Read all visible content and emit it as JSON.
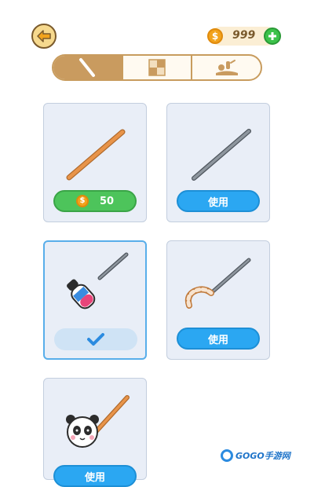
{
  "header": {
    "back_icon": "arrow-left-icon",
    "coins": "999",
    "coin_symbol": "$",
    "add_icon": "plus-icon"
  },
  "tabs": [
    {
      "icon": "stick-icon",
      "active": true
    },
    {
      "icon": "checker-icon",
      "active": false
    },
    {
      "icon": "scene-icon",
      "active": false
    }
  ],
  "items": [
    {
      "name": "wooden-stick",
      "state": "locked",
      "price": "50",
      "coin_symbol": "$"
    },
    {
      "name": "metal-needle",
      "state": "owned",
      "action_label": "使用"
    },
    {
      "name": "paintbrush-needle",
      "state": "equipped",
      "check_icon": "checkmark-icon"
    },
    {
      "name": "candy-cane-needle",
      "state": "owned",
      "action_label": "使用"
    },
    {
      "name": "panda-stick",
      "state": "owned",
      "action_label": "使用"
    }
  ],
  "watermark": {
    "text": "GOGO手游网"
  },
  "colors": {
    "buy_green": "#4dc45b",
    "use_blue": "#2ba7f2",
    "tab_active": "#c99b5f",
    "card_bg": "#e9eef7"
  }
}
